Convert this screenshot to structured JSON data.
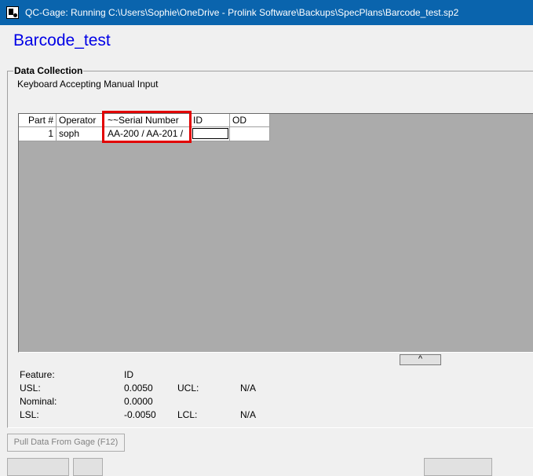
{
  "window": {
    "title": "QC-Gage: Running C:\\Users\\Sophie\\OneDrive - Prolink Software\\Backups\\SpecPlans\\Barcode_test.sp2",
    "app_icon": "qcgage-app-icon"
  },
  "document": {
    "title": "Barcode_test"
  },
  "data_collection": {
    "group_label": "Data Collection",
    "status": "Keyboard Accepting Manual Input",
    "columns": [
      "Part #",
      "Operator",
      "~~Serial Number",
      "ID",
      "OD"
    ],
    "rows": [
      {
        "part": "1",
        "operator": "soph",
        "serial": "AA-200 / AA-201 /",
        "id": "",
        "od": ""
      }
    ],
    "highlight_color": "#e20000",
    "scroll_button": "^"
  },
  "feature_info": {
    "feature_label": "Feature:",
    "feature_value": "ID",
    "usl_label": "USL:",
    "usl_value": "0.0050",
    "ucl_label": "UCL:",
    "ucl_value": "N/A",
    "nominal_label": "Nominal:",
    "nominal_value": "0.0000",
    "lsl_label": "LSL:",
    "lsl_value": "-0.0050",
    "lcl_label": "LCL:",
    "lcl_value": "N/A"
  },
  "actions": {
    "pull_data_label": "Pull Data From Gage (F12)"
  },
  "colors": {
    "titlebar": "#0a64ad",
    "doc_title": "#0000e6",
    "grid_background": "#ababab"
  }
}
